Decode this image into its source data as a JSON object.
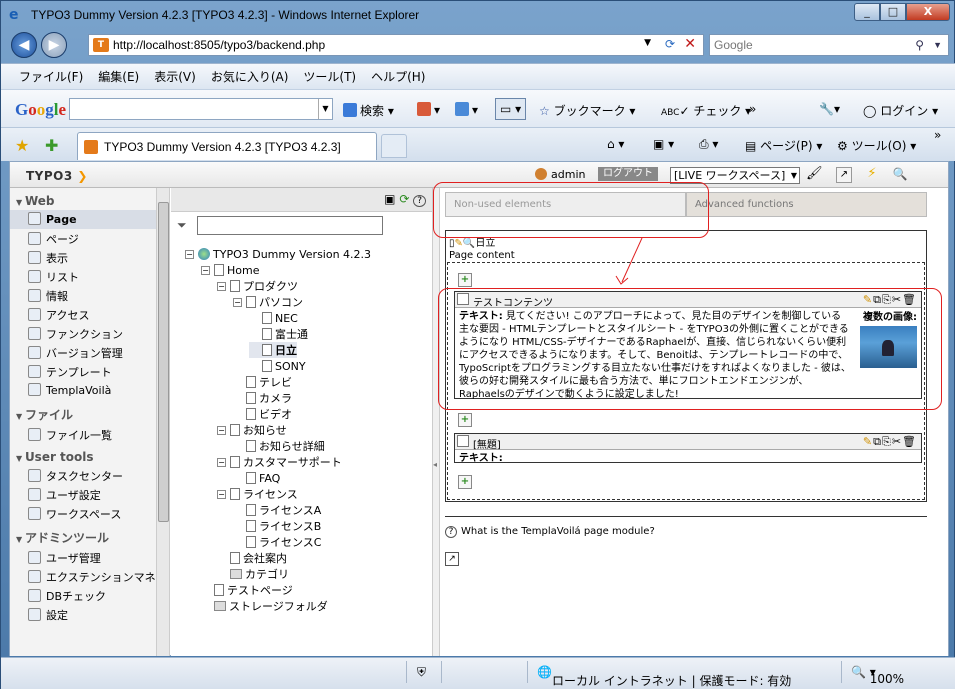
{
  "window": {
    "title": "TYPO3 Dummy Version 4.2.3 [TYPO3 4.2.3] - Windows Internet Explorer",
    "minimize": "_",
    "maximize": "□",
    "close": "X"
  },
  "address": {
    "url": "http://localhost:8505/typo3/backend.php",
    "search_placeholder": "Google"
  },
  "menubar": [
    "ファイル(F)",
    "編集(E)",
    "表示(V)",
    "お気に入り(A)",
    "ツール(T)",
    "ヘルプ(H)"
  ],
  "google_toolbar": {
    "logo": [
      "G",
      "o",
      "o",
      "g",
      "l",
      "e"
    ],
    "search_label": "検索",
    "bookmarks_label": "ブックマーク",
    "check_label": "チェック",
    "more": "»",
    "login_label": "ログイン"
  },
  "tabbar": {
    "tab_title": "TYPO3 Dummy Version 4.2.3 [TYPO3 4.2.3]",
    "page_label": "ページ(P)",
    "tools_label": "ツール(O)",
    "more": "»"
  },
  "typo3": {
    "logo_text": "TYPO3",
    "user": "admin",
    "logout_label": "ログアウト",
    "workspace": "[LIVE ワークスペース]"
  },
  "modules": [
    {
      "section": "Web",
      "items": [
        "Page",
        "ページ",
        "表示",
        "リスト",
        "情報",
        "アクセス",
        "ファンクション",
        "バージョン管理",
        "テンプレート",
        "TemplaVoilà"
      ],
      "active": "Page"
    },
    {
      "section": "ファイル",
      "items": [
        "ファイル一覧"
      ]
    },
    {
      "section": "User tools",
      "items": [
        "タスクセンター",
        "ユーザ設定",
        "ワークスペース"
      ]
    },
    {
      "section": "アドミンツール",
      "items": [
        "ユーザ管理",
        "エクステンションマネージャ",
        "DBチェック",
        "設定"
      ]
    }
  ],
  "tree": [
    {
      "label": "TYPO3 Dummy Version 4.2.3",
      "level": 0,
      "type": "root",
      "toggle": "−"
    },
    {
      "label": "Home",
      "level": 1,
      "type": "page",
      "toggle": "−"
    },
    {
      "label": "プロダクツ",
      "level": 2,
      "type": "page",
      "toggle": "−"
    },
    {
      "label": "パソコン",
      "level": 3,
      "type": "page",
      "toggle": "−"
    },
    {
      "label": "NEC",
      "level": 4,
      "type": "page"
    },
    {
      "label": "富士通",
      "level": 4,
      "type": "page"
    },
    {
      "label": "日立",
      "level": 4,
      "type": "page",
      "selected": true
    },
    {
      "label": "SONY",
      "level": 4,
      "type": "page"
    },
    {
      "label": "テレビ",
      "level": 3,
      "type": "page"
    },
    {
      "label": "カメラ",
      "level": 3,
      "type": "page"
    },
    {
      "label": "ビデオ",
      "level": 3,
      "type": "page"
    },
    {
      "label": "お知らせ",
      "level": 2,
      "type": "page",
      "toggle": "−"
    },
    {
      "label": "お知らせ詳細",
      "level": 3,
      "type": "page"
    },
    {
      "label": "カスタマーサポート",
      "level": 2,
      "type": "page",
      "toggle": "−"
    },
    {
      "label": "FAQ",
      "level": 3,
      "type": "page"
    },
    {
      "label": "ライセンス",
      "level": 2,
      "type": "page",
      "toggle": "−"
    },
    {
      "label": "ライセンスA",
      "level": 3,
      "type": "page"
    },
    {
      "label": "ライセンスB",
      "level": 3,
      "type": "page"
    },
    {
      "label": "ライセンスC",
      "level": 3,
      "type": "page"
    },
    {
      "label": "会社案内",
      "level": 2,
      "type": "page"
    },
    {
      "label": "カテゴリ",
      "level": 2,
      "type": "folder"
    },
    {
      "label": "テストページ",
      "level": 1,
      "type": "page"
    },
    {
      "label": "ストレージフォルダ",
      "level": 1,
      "type": "folder"
    }
  ],
  "main": {
    "tab_unused": "Non-used elements",
    "tab_advanced": "Advanced functions",
    "page_title": "日立",
    "page_content_label": "Page content",
    "ce1": {
      "title": "テストコンテンツ",
      "text_label": "テキスト:",
      "text": "見てください! このアプローチによって、見た目のデザインを制御している主な要因 - HTMLテンプレートとスタイルシート - をTYPO3の外側に置くことができるようになり HTML/CSS-デザイナーであるRaphaelが、直接、信じられないくらい便利にアクセスできるようになります。そして、Benoitは、テンプレートレコードの中で、TypoScriptをプログラミングする目立たない仕事だけをすればよくなりました - 彼は、彼らの好む開発スタイルに最も合う方法で、単にフロントエンドエンジンが、Raphaelsのデザインで動くように設定しました!",
      "images_label": "複数の画像:"
    },
    "ce2": {
      "title": "[無題]",
      "text_label": "テキスト:"
    },
    "help_text": "What is the TemplaVoilá page module?"
  },
  "statusbar": {
    "zone": "ローカル イントラネット | 保護モード: 有効",
    "zoom": "100%"
  }
}
